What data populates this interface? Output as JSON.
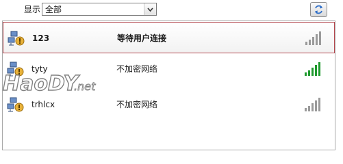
{
  "filter": {
    "label": "显示",
    "selected": "全部"
  },
  "networks": [
    {
      "name": "123",
      "status": "等待用户连接",
      "selected": true,
      "signal_color": "#9a9a9a"
    },
    {
      "name": "tyty",
      "status": "不加密网络",
      "selected": false,
      "signal_color": "#1f9a2e"
    },
    {
      "name": "trhlcx",
      "status": "不加密网络",
      "selected": false,
      "signal_color": "#9a9a9a"
    }
  ],
  "colors": {
    "selection_border": "#b4474e",
    "list_border": "#a8a8a8"
  },
  "icons": {
    "refresh": "refresh-icon",
    "network": "wireless-network-icon",
    "signal": "signal-strength-icon"
  },
  "watermark": "HaoDY.net"
}
